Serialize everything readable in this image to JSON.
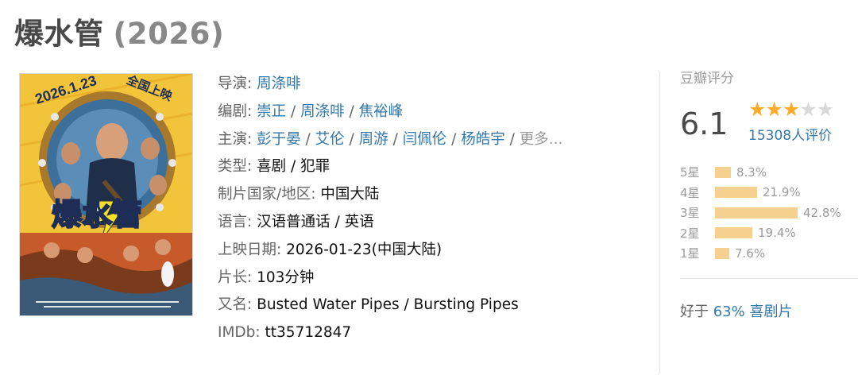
{
  "title": "爆水管",
  "year": "(2026)",
  "poster": {
    "top_text_date": "2026.1.23",
    "top_text_release": "全国上映",
    "logo_text": "爆水管"
  },
  "info": {
    "director_label": "导演",
    "directors": [
      "周涤啡"
    ],
    "writer_label": "编剧",
    "writers": [
      "崇正",
      "周涤啡",
      "焦裕峰"
    ],
    "cast_label": "主演",
    "cast": [
      "彭于晏",
      "艾伦",
      "周游",
      "闫佩伦",
      "杨皓宇"
    ],
    "cast_more": "更多...",
    "genre_label": "类型:",
    "genre_value": "喜剧 / 犯罪",
    "country_label": "制片国家/地区:",
    "country_value": "中国大陆",
    "language_label": "语言:",
    "language_value": "汉语普通话 / 英语",
    "release_label": "上映日期:",
    "release_value": "2026-01-23(中国大陆)",
    "runtime_label": "片长:",
    "runtime_value": "103分钟",
    "aka_label": "又名:",
    "aka_value": "Busted Water Pipes / Bursting Pipes",
    "imdb_label": "IMDb:",
    "imdb_value": "tt35712847"
  },
  "rating": {
    "title": "豆瓣评分",
    "score": "6.1",
    "stars_filled": 3,
    "stars_total": 5,
    "count_text": "15308人评价",
    "distribution": [
      {
        "label": "5星",
        "percent_text": "8.3%",
        "percent": 8.3
      },
      {
        "label": "4星",
        "percent_text": "21.9%",
        "percent": 21.9
      },
      {
        "label": "3星",
        "percent_text": "42.8%",
        "percent": 42.8
      },
      {
        "label": "2星",
        "percent_text": "19.4%",
        "percent": 19.4
      },
      {
        "label": "1星",
        "percent_text": "7.6%",
        "percent": 7.6
      }
    ],
    "better_than_prefix": "好于",
    "better_than_value": "63% 喜剧片"
  },
  "colors": {
    "link": "#3377aa",
    "star": "#ffac2d",
    "bar": "#f6d08e"
  }
}
